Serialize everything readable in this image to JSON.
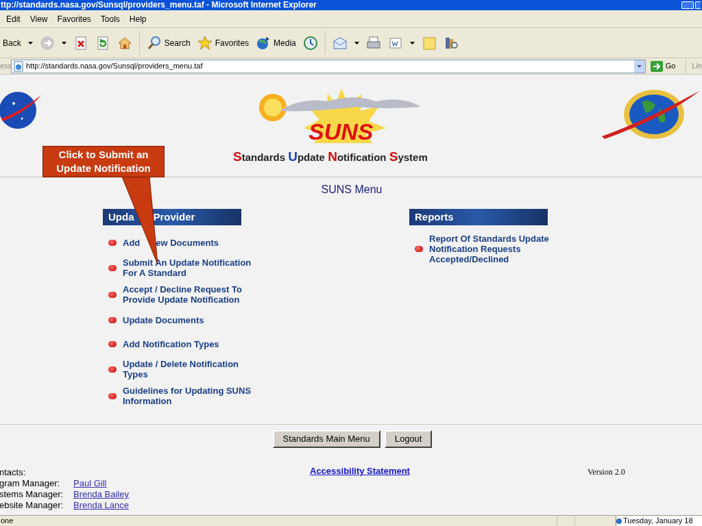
{
  "window": {
    "title": "ttp://standards.nasa.gov/Sunsql/providers_menu.taf - Microsoft Internet Explorer"
  },
  "menu_bar": [
    "Edit",
    "View",
    "Favorites",
    "Tools",
    "Help"
  ],
  "toolbar": [
    {
      "kind": "back",
      "label": "Back"
    },
    {
      "kind": "forward"
    },
    {
      "kind": "stop"
    },
    {
      "kind": "refresh"
    },
    {
      "kind": "home"
    },
    {
      "kind": "search",
      "label": "Search"
    },
    {
      "kind": "favorites",
      "label": "Favorites"
    },
    {
      "kind": "media",
      "label": "Media"
    },
    {
      "kind": "history"
    },
    {
      "kind": "mail"
    },
    {
      "kind": "print"
    },
    {
      "kind": "edit"
    },
    {
      "kind": "note"
    },
    {
      "kind": "research"
    }
  ],
  "address_bar": {
    "label": "ess",
    "url": "http://standards.nasa.gov/Sunsql/providers_menu.taf",
    "go": "Go",
    "links": "Lin"
  },
  "page": {
    "logo_title": "SUNS",
    "logo_subtitle": "Standards Update Notification System",
    "callout": "Click to Submit an Update Notification",
    "heading": "SUNS Menu",
    "sections": [
      {
        "title": [
          "Upda",
          "Provider"
        ],
        "items": [
          [
            "Add",
            "ew Documents"
          ],
          [
            "Submit An Update Notification For A Standard"
          ],
          [
            "Accept / Decline Request To Provide Update Notification"
          ],
          [
            "Update Documents"
          ],
          [
            "Add Notification Types"
          ],
          [
            "Update / Delete Notification Types"
          ],
          [
            "Guidelines for Updating SUNS Information"
          ]
        ]
      },
      {
        "title": [
          "Reports"
        ],
        "items": [
          [
            "Report Of Standards Update Notification Requests Accepted/Declined"
          ]
        ]
      }
    ],
    "buttons": [
      "Standards Main Menu",
      "Logout"
    ],
    "contacts_label": "ntacts:",
    "contacts": [
      {
        "role": "gram Manager:",
        "name": "Paul Gill"
      },
      {
        "role": "stems Manager:",
        "name": "Brenda Bailey"
      },
      {
        "role": "ebsite Manager:",
        "name": "Brenda Lance"
      }
    ],
    "accessibility_link": "Accessibility Statement",
    "version": "Version 2.0"
  },
  "status_bar": {
    "text": "one",
    "clock": "Tuesday, January 18"
  }
}
